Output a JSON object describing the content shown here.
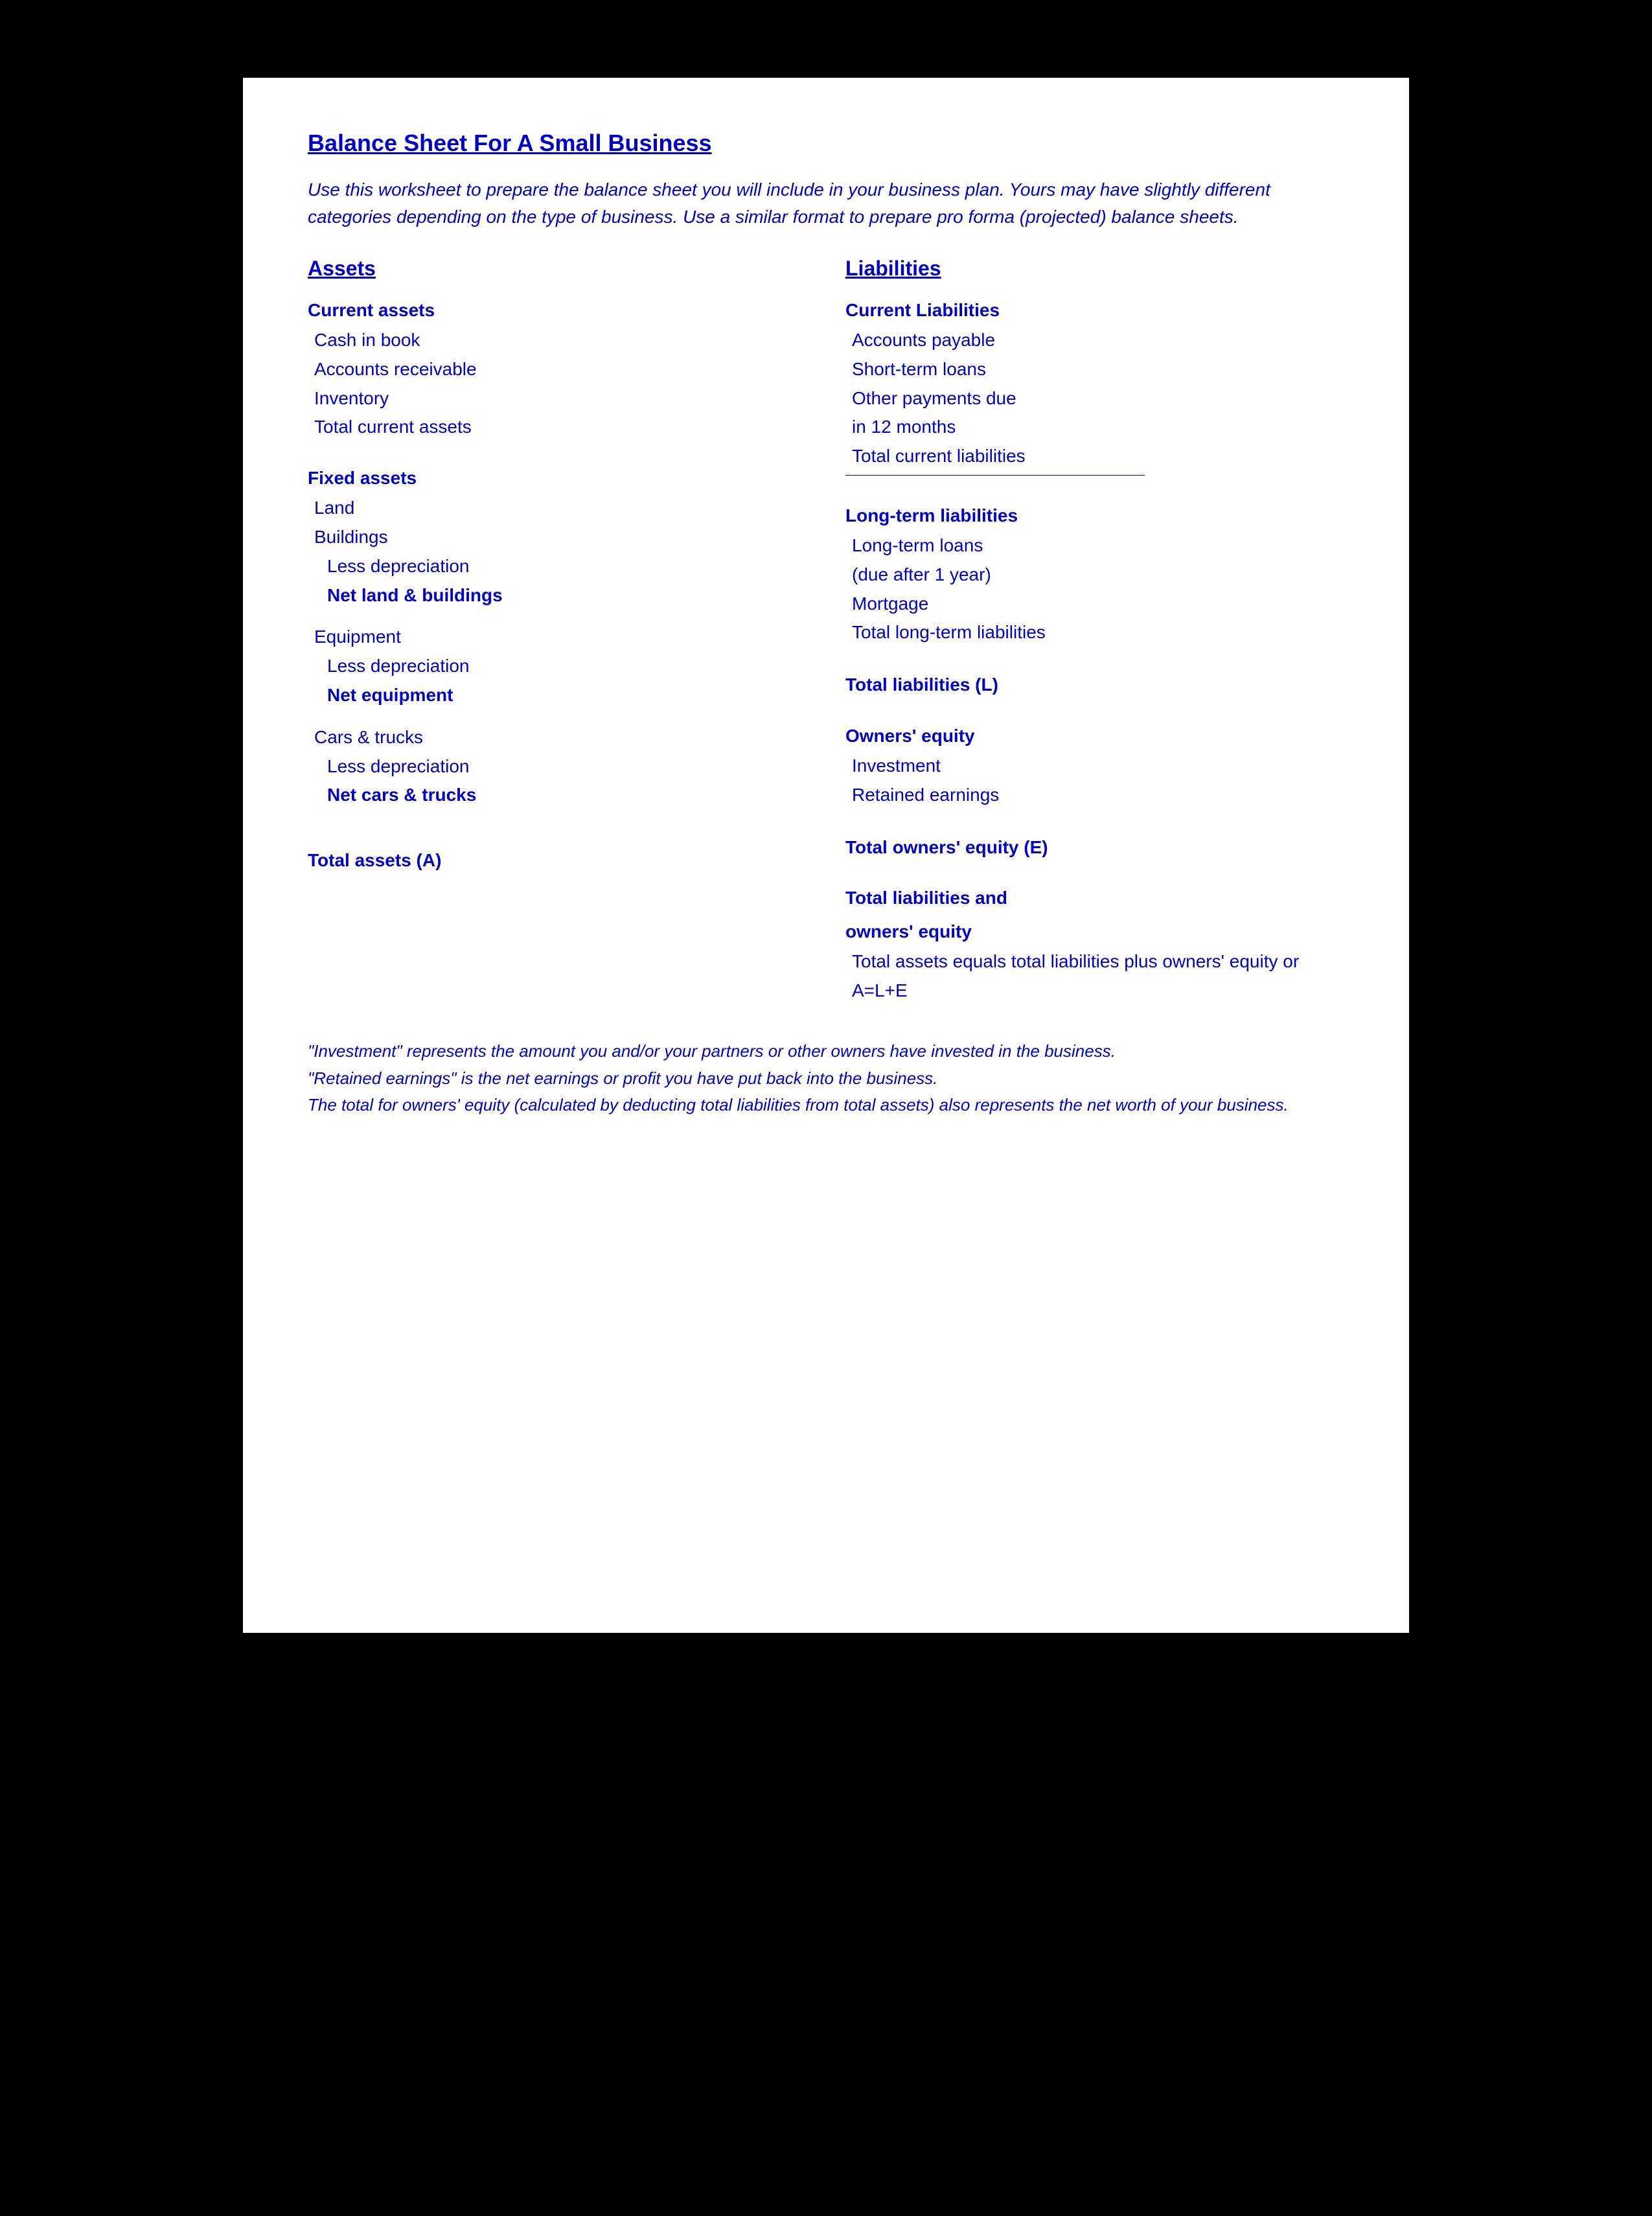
{
  "page": {
    "title": "Balance Sheet For A Small Business",
    "intro": "Use this worksheet to prepare the balance sheet you will include in your business plan.  Yours may have slightly different categories depending on the type of business.  Use a similar format to prepare pro forma (projected) balance sheets.",
    "assets": {
      "header": "Assets",
      "current_assets": {
        "label": "Current assets",
        "items": [
          "Cash in book",
          "Accounts receivable",
          "Inventory",
          "Total current assets"
        ]
      },
      "fixed_assets": {
        "label": "Fixed assets",
        "land": "Land",
        "buildings": "Buildings",
        "less_dep_buildings": "Less depreciation",
        "net_land": "Net land & buildings",
        "equipment_label": "Equipment",
        "less_dep_equip": "Less depreciation",
        "net_equipment": "Net equipment",
        "cars": "Cars & trucks",
        "less_dep_cars": "Less depreciation",
        "net_cars": "Net cars & trucks"
      },
      "total_assets": "Total assets (A)"
    },
    "liabilities": {
      "header": "Liabilities",
      "current_liabilities": {
        "label": "Current Liabilities",
        "items": [
          "Accounts payable",
          "Short-term loans",
          "Other payments due",
          " in 12 months",
          "Total current liabilities"
        ]
      },
      "long_term_liabilities": {
        "label": "Long-term liabilities",
        "items": [
          "Long-term loans",
          " (due after 1 year)",
          "Mortgage",
          "Total long-term liabilities"
        ]
      },
      "total_liabilities": "Total liabilities (L)",
      "owners_equity": {
        "label": "Owners' equity",
        "items": [
          "Investment",
          "Retained earnings"
        ],
        "total": "Total owners' equity (E)"
      },
      "total_liabilities_and": {
        "line1": "Total liabilities and",
        "line2": " owners' equity",
        "note": "Total assets equals total liabilities plus owners' equity or A=L+E"
      }
    },
    "footnotes": [
      "\"Investment\" represents the amount you and/or your partners or other owners have invested in the business.",
      "\"Retained earnings\" is the net earnings or profit you have put back into the business.",
      "The total for owners' equity (calculated by deducting total liabilities from total assets) also represents the net worth of your business."
    ]
  }
}
